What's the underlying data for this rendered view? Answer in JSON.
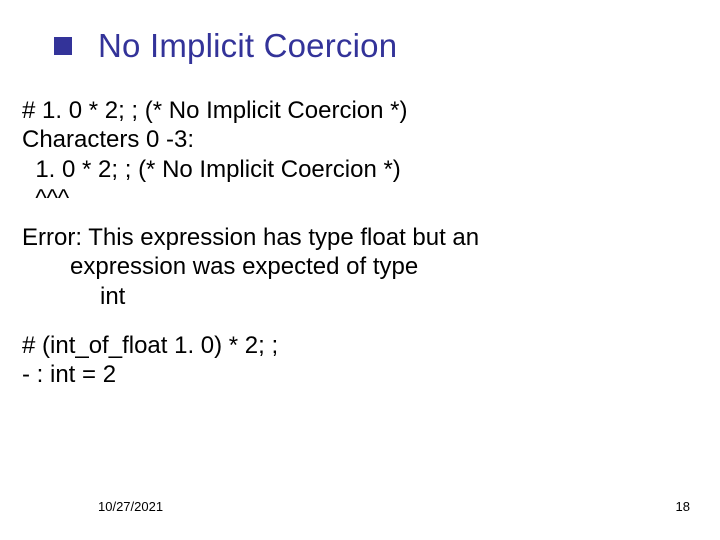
{
  "slide": {
    "title": "No Implicit Coercion",
    "body": {
      "l1": "# 1. 0 * 2; ; (* No Implicit Coercion *)",
      "l2": "Characters 0 -3:",
      "l3": "  1. 0 * 2; ; (* No Implicit Coercion *)",
      "l4": "  ^^^",
      "l5": "Error: This expression has type float but an",
      "l6": "expression was expected of type",
      "l7": "int",
      "l8": "# (int_of_float 1. 0) * 2; ;",
      "l9": "- : int = 2"
    },
    "footer": {
      "date": "10/27/2021",
      "page": "18"
    }
  }
}
